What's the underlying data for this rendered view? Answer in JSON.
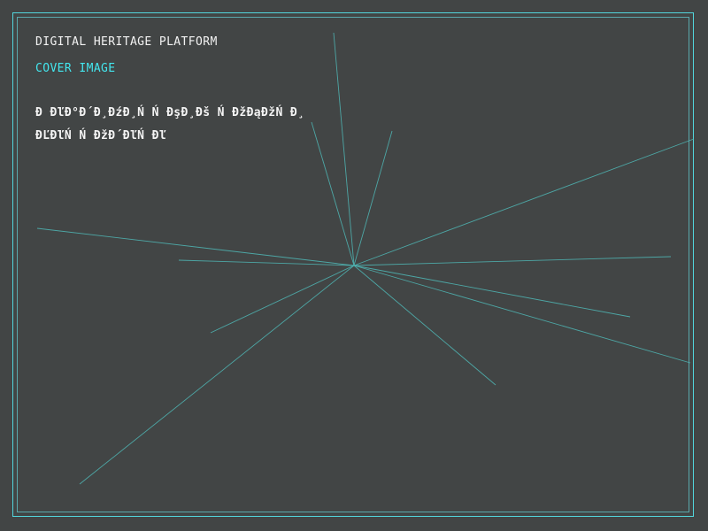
{
  "header": {
    "title": "DIGITAL HERITAGE PLATFORM",
    "subtitle": "COVER IMAGE"
  },
  "body": {
    "line_1": "Đ ĐľĐ°Đ´Đ¸ĐźĐ¸Ń Ń ĐşĐ¸Đš Ń ĐžĐąĐžŃ  Đ¸",
    "line_2": "ĐĽĐľŃ Ń ĐžĐ´ĐľŃ Đľ"
  },
  "colors": {
    "background": "#424545",
    "frame": "#52d6dc",
    "accent_text": "#43e6ee",
    "rays": "#4fb8b6"
  }
}
